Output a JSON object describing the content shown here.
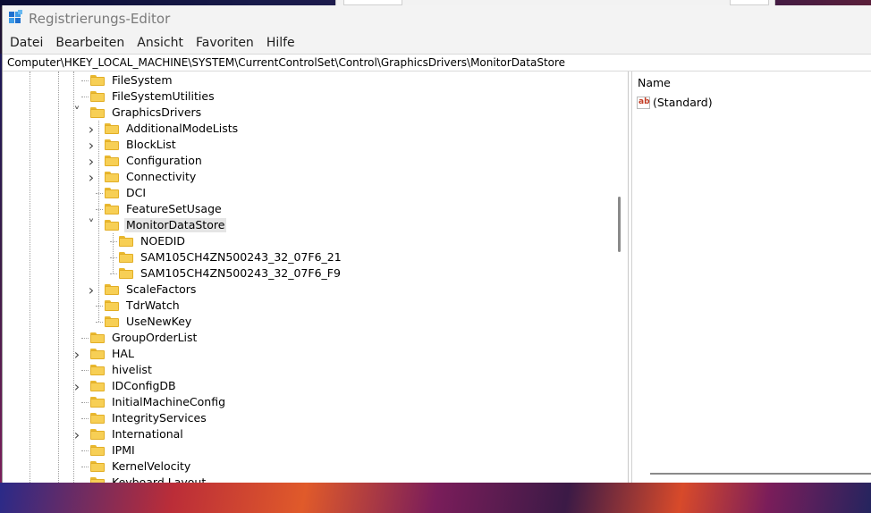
{
  "window": {
    "title": "Registrierungs-Editor",
    "icon": "registry-editor-icon"
  },
  "menu": [
    "Datei",
    "Bearbeiten",
    "Ansicht",
    "Favoriten",
    "Hilfe"
  ],
  "address": "Computer\\HKEY_LOCAL_MACHINE\\SYSTEM\\CurrentControlSet\\Control\\GraphicsDrivers\\MonitorDataStore",
  "tree": {
    "nodes": [
      {
        "label": "FileSystem",
        "level": 0,
        "expander": "none"
      },
      {
        "label": "FileSystemUtilities",
        "level": 0,
        "expander": "none"
      },
      {
        "label": "GraphicsDrivers",
        "level": 0,
        "expander": "expanded"
      },
      {
        "label": "AdditionalModeLists",
        "level": 1,
        "expander": "collapsed"
      },
      {
        "label": "BlockList",
        "level": 1,
        "expander": "collapsed"
      },
      {
        "label": "Configuration",
        "level": 1,
        "expander": "collapsed"
      },
      {
        "label": "Connectivity",
        "level": 1,
        "expander": "collapsed"
      },
      {
        "label": "DCI",
        "level": 1,
        "expander": "none"
      },
      {
        "label": "FeatureSetUsage",
        "level": 1,
        "expander": "none"
      },
      {
        "label": "MonitorDataStore",
        "level": 1,
        "expander": "expanded",
        "selected": true
      },
      {
        "label": "NOEDID",
        "level": 2,
        "expander": "none"
      },
      {
        "label": "SAM105CH4ZN500243_32_07F6_21",
        "level": 2,
        "expander": "none"
      },
      {
        "label": "SAM105CH4ZN500243_32_07F6_F9",
        "level": 2,
        "expander": "none"
      },
      {
        "label": "ScaleFactors",
        "level": 1,
        "expander": "collapsed"
      },
      {
        "label": "TdrWatch",
        "level": 1,
        "expander": "none"
      },
      {
        "label": "UseNewKey",
        "level": 1,
        "expander": "none"
      },
      {
        "label": "GroupOrderList",
        "level": 0,
        "expander": "none"
      },
      {
        "label": "HAL",
        "level": 0,
        "expander": "collapsed"
      },
      {
        "label": "hivelist",
        "level": 0,
        "expander": "none"
      },
      {
        "label": "IDConfigDB",
        "level": 0,
        "expander": "collapsed"
      },
      {
        "label": "InitialMachineConfig",
        "level": 0,
        "expander": "none"
      },
      {
        "label": "IntegrityServices",
        "level": 0,
        "expander": "none"
      },
      {
        "label": "International",
        "level": 0,
        "expander": "collapsed"
      },
      {
        "label": "IPMI",
        "level": 0,
        "expander": "none"
      },
      {
        "label": "KernelVelocity",
        "level": 0,
        "expander": "none"
      },
      {
        "label": "Keyboard Layout",
        "level": 0,
        "expander": "none"
      }
    ]
  },
  "values_pane": {
    "column_name": "Name",
    "rows": [
      {
        "icon": "string-value-icon",
        "icon_text": "ab",
        "name": "(Standard)"
      }
    ]
  },
  "colors": {
    "folder": "#f7cf55",
    "selection": "#e5e5e5",
    "string_icon": "#c23b22"
  }
}
